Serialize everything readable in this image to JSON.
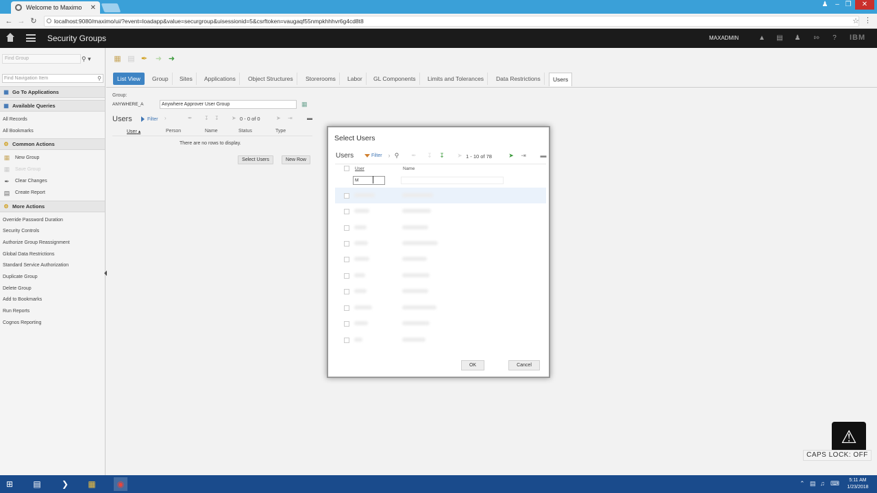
{
  "browser": {
    "tab_title": "Welcome to Maximo",
    "tab_close": "✕",
    "url": "localhost:9080/maximo/ui/?event=loadapp&value=securgroup&uisessionid=5&csrftoken=vaugaqf55nmpkhhhvr6g4cd8t8"
  },
  "header": {
    "app_title": "Security Groups",
    "user": "MAXADMIN",
    "logo": "IBM"
  },
  "left": {
    "find_group_placeholder": "Find Group",
    "find_nav_placeholder": "Find Navigation Item",
    "go_to_apps": "Go To Applications",
    "available_queries": "Available Queries",
    "all_records": "All Records",
    "all_bookmarks": "All Bookmarks",
    "common_actions": "Common Actions",
    "new_group": "New Group",
    "save_group": "Save Group",
    "clear_changes": "Clear Changes",
    "create_report": "Create Report",
    "more_actions": "More Actions",
    "more_items": [
      "Override Password Duration",
      "Security Controls",
      "Authorize Group Reassignment",
      "Global Data Restrictions",
      "Standard Service Authorization",
      "Duplicate Group",
      "Delete Group",
      "Add to Bookmarks",
      "Run Reports",
      "Cognos Reporting"
    ]
  },
  "tabs": [
    "List View",
    "Group",
    "Sites",
    "Applications",
    "Object Structures",
    "Storerooms",
    "Labor",
    "GL Components",
    "Limits and Tolerances",
    "Data Restrictions",
    "Users"
  ],
  "main": {
    "group_label": "Group:",
    "group_code": "ANYWHERE_A",
    "group_desc": "Anywhere Approver User Group",
    "users_title": "Users",
    "filter": "Filter",
    "pager": "0 - 0 of 0",
    "columns": [
      "User",
      "Person",
      "Name",
      "Status",
      "Type"
    ],
    "no_rows": "There are no rows to display.",
    "select_users_btn": "Select Users",
    "new_row_btn": "New Row"
  },
  "dialog": {
    "title": "Select Users",
    "users": "Users",
    "filter": "Filter",
    "pager": "1 - 10 of 78",
    "col_user": "User",
    "col_name": "Name",
    "filter_value": "M",
    "ok": "OK",
    "cancel": "Cancel"
  },
  "caps": {
    "label": "CAPS LOCK: OFF"
  },
  "clock": {
    "time": "5:11 AM",
    "date": "1/23/2018"
  },
  "colors": {
    "accent": "#3e84c4",
    "header_bg": "#1b1b1b",
    "taskbar": "#1a4b8c",
    "browser_chrome": "#3aa0d8"
  }
}
